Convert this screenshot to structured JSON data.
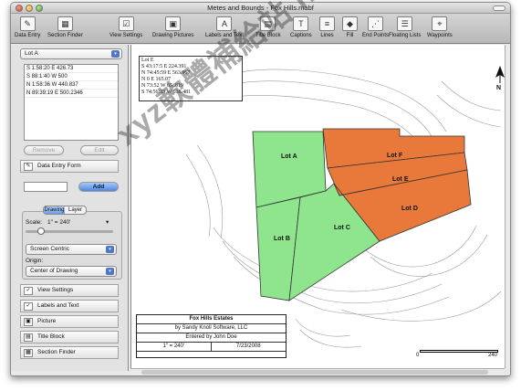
{
  "window": {
    "title": "Metes and Bounds - Fox Hills.mabf"
  },
  "toolbar": {
    "items": [
      {
        "label": "Data Entry",
        "icon": "data-entry-icon",
        "glyph": "✎"
      },
      {
        "label": "Section Finder",
        "icon": "section-finder-icon",
        "glyph": "▦"
      },
      {
        "label": "View Settings",
        "icon": "view-settings-icon",
        "glyph": "☑"
      },
      {
        "label": "Drawing Pictures",
        "icon": "drawing-pictures-icon",
        "glyph": "▣"
      },
      {
        "label": "Labels and Text",
        "icon": "labels-text-icon",
        "glyph": "A"
      },
      {
        "label": "Title Block",
        "icon": "title-block-icon",
        "glyph": "▤"
      },
      {
        "label": "Captions",
        "icon": "captions-icon",
        "glyph": "T"
      },
      {
        "label": "Lines",
        "icon": "lines-icon",
        "glyph": "≡"
      },
      {
        "label": "Fill",
        "icon": "fill-icon",
        "glyph": "◆"
      },
      {
        "label": "End Points",
        "icon": "end-points-icon",
        "glyph": "⋰"
      },
      {
        "label": "Floating Lists",
        "icon": "floating-lists-icon",
        "glyph": "☰"
      },
      {
        "label": "Waypoints",
        "icon": "waypoints-icon",
        "glyph": "⌖"
      }
    ]
  },
  "sidebar": {
    "lot_select": "Lot A",
    "calls": [
      "S 1:58:20 E 426.73",
      "S 88:1:40 W 500",
      "N 1:58:36 W 440.837",
      "N 89:39:19 E 500.2346"
    ],
    "remove_label": "Remove",
    "edit_label": "Edit",
    "data_entry_form_label": "Data Entry Form",
    "add_label": "Add",
    "tabs": [
      "Drawing",
      "Layer"
    ],
    "scale_label": "Scale:",
    "scale_value": "1\" = 240'",
    "screen_mode": "Screen Centric",
    "origin_label": "Origin:",
    "origin_value": "Center of Drawing",
    "commands": [
      "View Settings",
      "Labels and Text",
      "Picture",
      "Title Block",
      "Section Finder"
    ],
    "slider_level": 0.15
  },
  "drawing": {
    "lot_callout": {
      "title": "Lot E",
      "lines": [
        "S 43:17:5 E 224.391",
        "N 74:45:59 E 563.967",
        "N 0 E 165.07",
        "N 73:52 W 65..819",
        "S 74:56:33 W 538.481"
      ]
    },
    "lots": {
      "A": "Lot A",
      "B": "Lot B",
      "C": "Lot C",
      "D": "Lot D",
      "E": "Lot E",
      "F": "Lot F"
    },
    "colors": {
      "green": "#8ee58e",
      "orange": "#e8793a",
      "contour": "#9a9a9a"
    },
    "title_block": {
      "title": "Fox Hills Estates",
      "author": "by Sandy Knoll Software, LLC",
      "entered": "Entered by John Doe",
      "scale": "1\" = 240'",
      "date": "7/23/2008"
    },
    "scalebar": {
      "start": "0",
      "end": "240"
    },
    "north": "N"
  },
  "watermark": "xyz軟體補給站 http://31.to"
}
